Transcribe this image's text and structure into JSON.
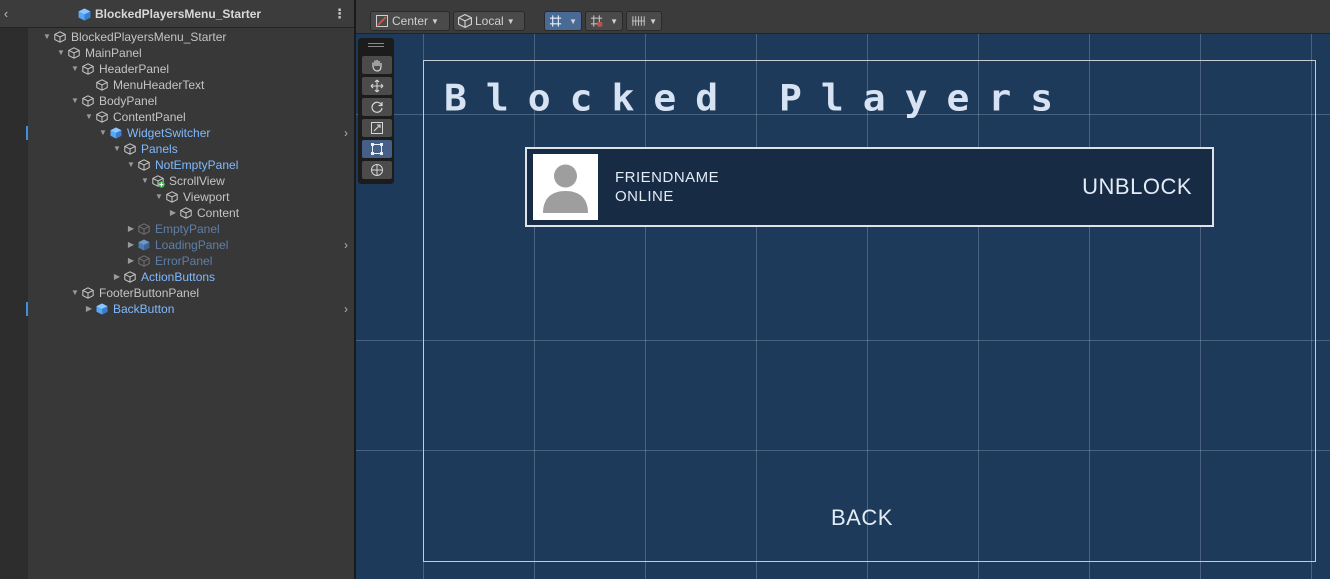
{
  "hierarchy": {
    "title": "BlockedPlayersMenu_Starter",
    "items": [
      {
        "label": "BlockedPlayersMenu_Starter",
        "depth": 0,
        "expanded": true,
        "type": "object"
      },
      {
        "label": "MainPanel",
        "depth": 1,
        "expanded": true,
        "type": "object"
      },
      {
        "label": "HeaderPanel",
        "depth": 2,
        "expanded": true,
        "type": "object"
      },
      {
        "label": "MenuHeaderText",
        "depth": 3,
        "expanded": null,
        "type": "object"
      },
      {
        "label": "BodyPanel",
        "depth": 2,
        "expanded": true,
        "type": "object"
      },
      {
        "label": "ContentPanel",
        "depth": 3,
        "expanded": true,
        "type": "object"
      },
      {
        "label": "WidgetSwitcher",
        "depth": 4,
        "expanded": true,
        "type": "prefab",
        "arrow": true,
        "marked": true
      },
      {
        "label": "Panels",
        "depth": 5,
        "expanded": true,
        "type": "prefab-child"
      },
      {
        "label": "NotEmptyPanel",
        "depth": 6,
        "expanded": true,
        "type": "prefab-child"
      },
      {
        "label": "ScrollView",
        "depth": 7,
        "expanded": true,
        "type": "object",
        "added": true
      },
      {
        "label": "Viewport",
        "depth": 8,
        "expanded": true,
        "type": "object"
      },
      {
        "label": "Content",
        "depth": 9,
        "expanded": false,
        "type": "object"
      },
      {
        "label": "EmptyPanel",
        "depth": 6,
        "expanded": false,
        "type": "inactive"
      },
      {
        "label": "LoadingPanel",
        "depth": 6,
        "expanded": false,
        "type": "inactive-prefab",
        "arrow": true
      },
      {
        "label": "ErrorPanel",
        "depth": 6,
        "expanded": false,
        "type": "inactive"
      },
      {
        "label": "ActionButtons",
        "depth": 5,
        "expanded": false,
        "type": "prefab-child"
      },
      {
        "label": "FooterButtonPanel",
        "depth": 2,
        "expanded": true,
        "type": "object"
      },
      {
        "label": "BackButton",
        "depth": 3,
        "expanded": false,
        "type": "prefab",
        "arrow": true,
        "marked": true
      }
    ]
  },
  "toolbar": {
    "pivot_label": "Center",
    "space_label": "Local"
  },
  "scene": {
    "menu_title": "Blocked Players",
    "friend_name": "FRIENDNAME",
    "friend_status": "ONLINE",
    "unblock_label": "UNBLOCK",
    "back_label": "BACK"
  },
  "colors": {
    "scene_bg": "#1e3a5b",
    "prefab_text": "#7fbaff",
    "inactive_text": "#5f7fa8"
  }
}
